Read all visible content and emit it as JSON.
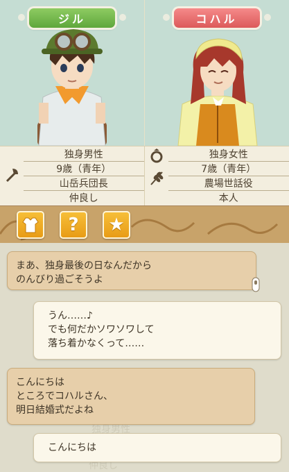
{
  "characters": [
    {
      "name": "ジル",
      "plate_color": "#6eb64a",
      "info": [
        "独身男性",
        "9歳（青年）",
        "山岳兵団長",
        "仲良し"
      ],
      "icon": "axe-icon"
    },
    {
      "name": "コハル",
      "plate_color": "#e46a6a",
      "info": [
        "独身女性",
        "7歳（青年）",
        "農場世話役",
        "本人"
      ],
      "icons": [
        "ring-icon",
        "wheat-icon"
      ]
    }
  ],
  "tabs": [
    {
      "name": "outfit",
      "icon": "shirt-icon"
    },
    {
      "name": "help",
      "label": "?"
    },
    {
      "name": "favorite",
      "label": "★"
    }
  ],
  "messages": [
    {
      "side": "left",
      "lines": [
        "まあ、独身最後の日なんだから",
        "のんびり過ごそうよ"
      ]
    },
    {
      "side": "right",
      "lines": [
        "うん……♪",
        "でも何だかソワソワして",
        "落ち着かなくって……"
      ]
    },
    {
      "side": "left",
      "lines": [
        "こんにちは",
        "ところでコハルさん、",
        "明日結婚式だよね"
      ]
    },
    {
      "side": "right",
      "lines": [
        "こんにちは"
      ]
    }
  ],
  "background_ghost": [
    "独身男性",
    "仲良し"
  ]
}
